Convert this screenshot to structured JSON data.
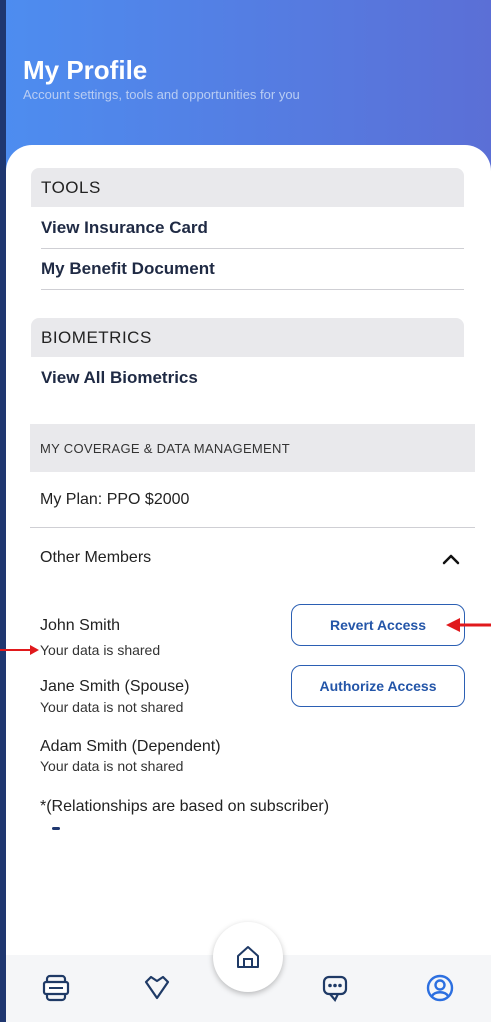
{
  "header": {
    "title": "My Profile",
    "subtitle": "Account settings, tools and opportunities for you"
  },
  "tools": {
    "heading": "TOOLS",
    "items": [
      "View Insurance Card",
      "My Benefit Document"
    ]
  },
  "biometrics": {
    "heading": "BIOMETRICS",
    "items": [
      "View All Biometrics"
    ]
  },
  "coverage": {
    "heading": "MY COVERAGE & DATA MANAGEMENT",
    "plan": "My Plan: PPO $2000",
    "other_members_label": "Other Members",
    "members": [
      {
        "name": "John Smith",
        "status": "Your data is shared",
        "action": "Revert Access"
      },
      {
        "name": "Jane Smith (Spouse)",
        "status": "Your data is not shared",
        "action": "Authorize Access"
      },
      {
        "name": "Adam Smith (Dependent)",
        "status": "Your data is not shared",
        "action": ""
      }
    ],
    "note": "*(Relationships are based on subscriber)"
  },
  "tabbar": {
    "icons": [
      "id-card-icon",
      "heart-tag-icon",
      "home-icon",
      "chat-bubble-icon",
      "profile-icon"
    ]
  },
  "colors": {
    "header_gradient_start": "#4d8df0",
    "header_gradient_end": "#5b6fd6",
    "accent_blue": "#2355a8",
    "annotation_red": "#e0191c"
  }
}
